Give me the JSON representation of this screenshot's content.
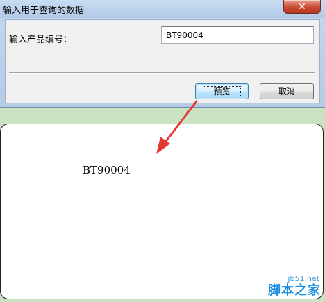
{
  "dialog": {
    "title": "输入用于查询的数据",
    "close_symbol": "✕",
    "field_label": "输入产品编号：",
    "field_value": "BT90004",
    "preview_button": "预览",
    "cancel_button": "取消"
  },
  "preview": {
    "text": "BT90004"
  },
  "watermark": {
    "url": "jb51.net",
    "brand": "脚本之家"
  },
  "colors": {
    "annotation_arrow": "#e53935",
    "page_background": "#c9e3c2"
  }
}
